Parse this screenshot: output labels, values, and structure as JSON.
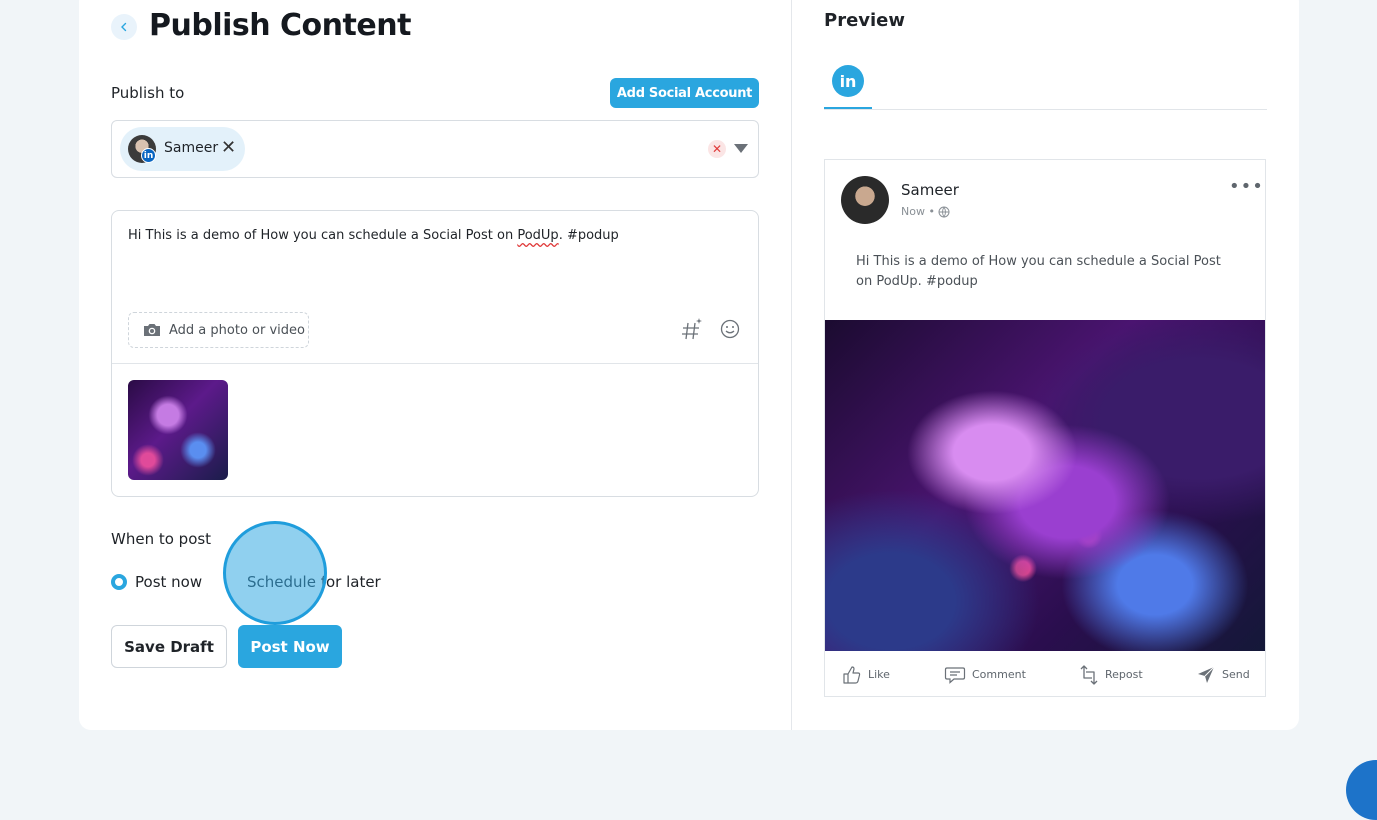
{
  "page": {
    "title": "Publish Content",
    "back_icon": "chevron-left-icon"
  },
  "publish": {
    "label": "Publish to",
    "add_account_label": "Add Social Account",
    "selected_account": {
      "name": "Sameer",
      "network": "LinkedIn"
    },
    "clear_icon": "close-icon",
    "dropdown_icon": "caret-down-icon"
  },
  "composer": {
    "text_before": "Hi This is a demo of How you can schedule a Social Post on ",
    "text_misspelled": "PodUp",
    "text_after": ". #podup",
    "add_media_label": "Add a photo or video",
    "media_count": 1
  },
  "schedule": {
    "label": "When to post",
    "options": [
      "Post now",
      "Schedule for later"
    ],
    "selected": "Post now"
  },
  "actions": {
    "save_draft": "Save Draft",
    "post_now": "Post Now"
  },
  "preview": {
    "title": "Preview",
    "tab": "in",
    "author": "Sameer",
    "meta": "Now •",
    "text": "Hi This is a demo of How you can schedule a Social Post on PodUp. #podup",
    "actions": [
      "Like",
      "Comment",
      "Repost",
      "Send"
    ]
  },
  "colors": {
    "accent": "#2aa6df",
    "linkedin": "#0a66c2",
    "background": "#f1f5f8"
  }
}
